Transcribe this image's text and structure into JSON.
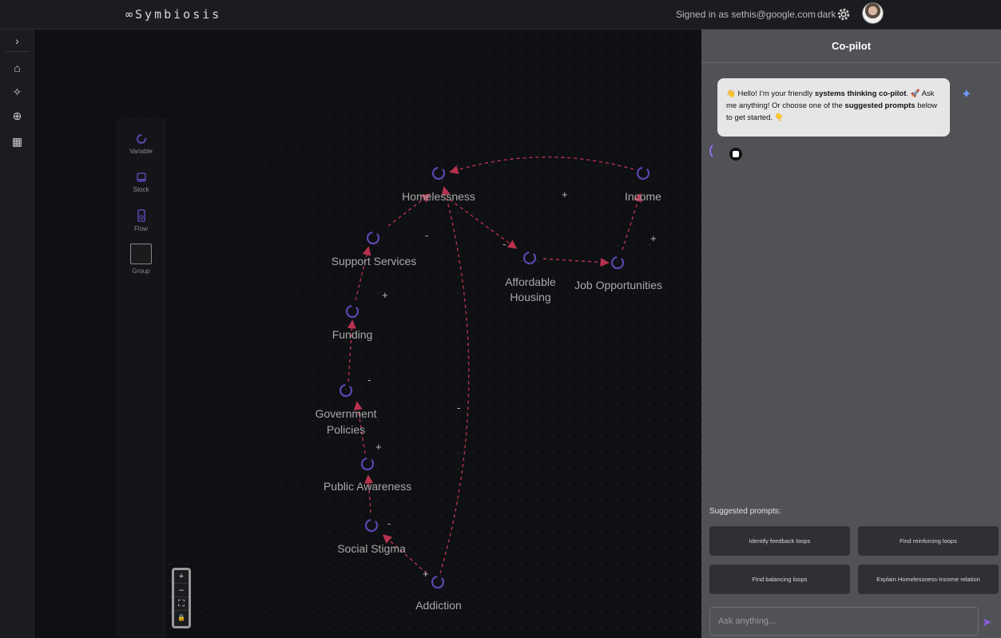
{
  "app": {
    "logo": "∞Symbiosis",
    "signed_in": "Signed in as sethis@google.com",
    "theme": "dark"
  },
  "nav": {
    "items": [
      {
        "icon": "chevron-right-icon",
        "glyph": "›"
      },
      {
        "icon": "home-icon",
        "glyph": "⌂"
      },
      {
        "icon": "wand-icon",
        "glyph": "✧"
      },
      {
        "icon": "add-circle-icon",
        "glyph": "⊕"
      },
      {
        "icon": "dashboard-icon",
        "glyph": "▦"
      }
    ]
  },
  "palette": {
    "variable": "Variable",
    "stock": "Stock",
    "flow": "Flow",
    "group": "Group"
  },
  "zoom": {
    "in": "+",
    "out": "–",
    "fit": "⛶",
    "lock": "🔒"
  },
  "graph": {
    "nodes": [
      {
        "id": "homelessness",
        "label": "Homelessness"
      },
      {
        "id": "income",
        "label": "Income"
      },
      {
        "id": "support_services",
        "label": "Support Services"
      },
      {
        "id": "affordable_housing",
        "label_line1": "Affordable",
        "label_line2": "Housing"
      },
      {
        "id": "job_opportunities",
        "label": "Job Opportunities"
      },
      {
        "id": "funding",
        "label": "Funding"
      },
      {
        "id": "government_policies",
        "label_line1": "Government",
        "label_line2": "Policies"
      },
      {
        "id": "public_awareness",
        "label": "Public Awareness"
      },
      {
        "id": "social_stigma",
        "label": "Social Stigma"
      },
      {
        "id": "addiction",
        "label": "Addiction"
      }
    ],
    "polarities": {
      "income_homelessness": "+",
      "support_homelessness": "-",
      "homelessness_affordable": "-",
      "jobs_income": "+",
      "funding_support": "+",
      "gov_funding": "-",
      "awareness_gov": "+",
      "addiction_homelessness": "-",
      "stigma_awareness": "-",
      "addiction_stigma": "+"
    }
  },
  "copilot": {
    "title": "Co-pilot",
    "greeting_part1": "Hello! I'm your friendly ",
    "greeting_bold1": "systems thinking co-pilot",
    "greeting_part2": ". 🚀 Ask me anything! Or choose one of the ",
    "greeting_bold2": "suggested prompts",
    "greeting_part3": " below to get started. 👇",
    "wave": "👋",
    "sparkle": "✦",
    "suggested_title": "Suggested prompts:",
    "prompts": [
      "Identify feedback loops",
      "Find reinforcing loops",
      "Find balancing loops",
      "Explain Homelessness-Income relation"
    ],
    "input_placeholder": "Ask anything...",
    "send": "➤"
  },
  "colors": {
    "accent": "#8c6ee6",
    "edge": "#b8324f",
    "node": "#5a47b0"
  }
}
